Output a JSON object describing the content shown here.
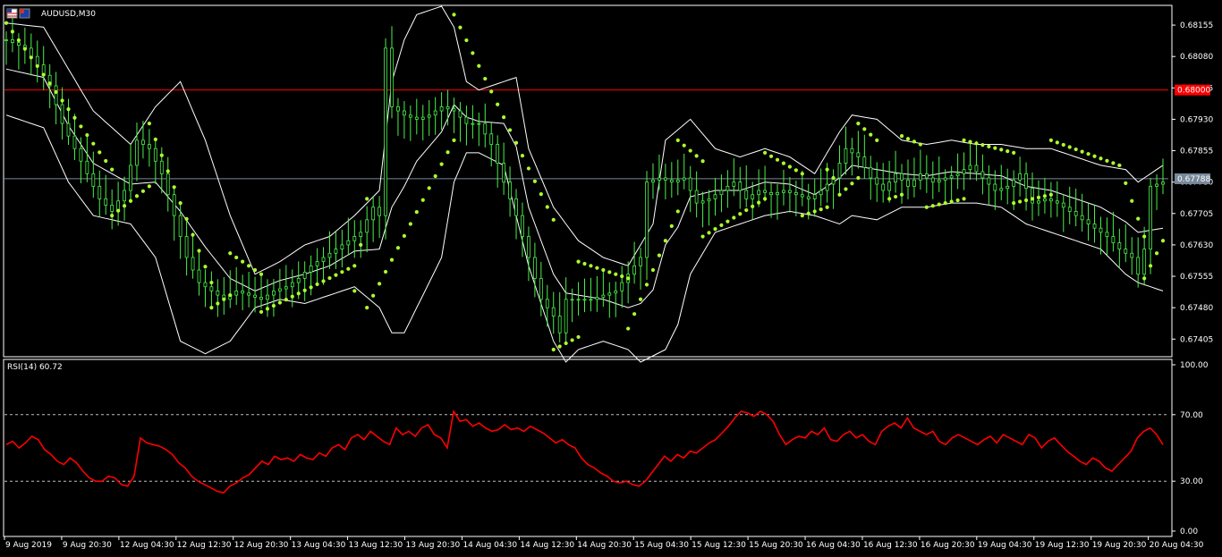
{
  "main_panel": {
    "symbol_label": "AUDUSD,M30",
    "flag_icon": "au-us-flag-icon"
  },
  "rsi_panel": {
    "label": "RSI(14) 60.72"
  },
  "colors": {
    "background": "#000000",
    "frame": "#ffffff",
    "candles": "#49f049",
    "bollinger": "#ffffff",
    "sar": "#adff2f",
    "rsi_line": "#ff0000",
    "level_line_red": "#ff0000",
    "bid_line": "#778899",
    "tag_bg": "#ff0000",
    "tag_bid_bg": "#778899"
  },
  "chart_data": [
    {
      "type": "line",
      "name": "AUDUSD M30 price (candles with Bollinger Bands and Parabolic SAR)",
      "y_ticks": [
        "0.68155",
        "0.68080",
        "0.68005",
        "0.67930",
        "0.67855",
        "0.67780",
        "0.67705",
        "0.67630",
        "0.67555",
        "0.67480",
        "0.67405"
      ],
      "ylim": [
        0.67365,
        0.682
      ],
      "horizontal_level": {
        "value": 0.68,
        "label": "0.68000"
      },
      "current_price": {
        "value": 0.67788,
        "label": "0.67788"
      },
      "x_ticks": [
        "9 Aug 2019",
        "9 Aug 20:30",
        "12 Aug 04:30",
        "12 Aug 12:30",
        "12 Aug 20:30",
        "13 Aug 04:30",
        "13 Aug 12:30",
        "13 Aug 20:30",
        "14 Aug 04:30",
        "14 Aug 12:30",
        "14 Aug 20:30",
        "15 Aug 04:30",
        "15 Aug 12:30",
        "15 Aug 20:30",
        "16 Aug 04:30",
        "16 Aug 12:30",
        "16 Aug 20:30",
        "19 Aug 04:30",
        "19 Aug 12:30",
        "19 Aug 20:30",
        "20 Aug 04:30"
      ],
      "close_path": [
        [
          0,
          0.6812
        ],
        [
          3,
          0.681
        ],
        [
          5,
          0.6806
        ],
        [
          7,
          0.6801
        ],
        [
          9,
          0.6792
        ],
        [
          11,
          0.6786
        ],
        [
          13,
          0.678
        ],
        [
          15,
          0.6774
        ],
        [
          17,
          0.6771
        ],
        [
          19,
          0.6776
        ],
        [
          21,
          0.6788
        ],
        [
          23,
          0.6786
        ],
        [
          25,
          0.678
        ],
        [
          27,
          0.677
        ],
        [
          29,
          0.676
        ],
        [
          31,
          0.6754
        ],
        [
          33,
          0.6752
        ],
        [
          35,
          0.675
        ],
        [
          37,
          0.6752
        ],
        [
          39,
          0.6751
        ],
        [
          41,
          0.675
        ],
        [
          43,
          0.6752
        ],
        [
          45,
          0.6753
        ],
        [
          47,
          0.6755
        ],
        [
          49,
          0.6758
        ],
        [
          51,
          0.676
        ],
        [
          53,
          0.6762
        ],
        [
          55,
          0.6764
        ],
        [
          57,
          0.6766
        ],
        [
          59,
          0.6772
        ],
        [
          60,
          0.677
        ],
        [
          61,
          0.681
        ],
        [
          62,
          0.6796
        ],
        [
          64,
          0.6794
        ],
        [
          66,
          0.6793
        ],
        [
          68,
          0.6794
        ],
        [
          70,
          0.6796
        ],
        [
          72,
          0.6795
        ],
        [
          74,
          0.6792
        ],
        [
          76,
          0.6792
        ],
        [
          78,
          0.6787
        ],
        [
          80,
          0.6778
        ],
        [
          82,
          0.677
        ],
        [
          84,
          0.676
        ],
        [
          86,
          0.675
        ],
        [
          88,
          0.6746
        ],
        [
          89,
          0.6742
        ],
        [
          90,
          0.675
        ],
        [
          92,
          0.675
        ],
        [
          94,
          0.675
        ],
        [
          96,
          0.6751
        ],
        [
          98,
          0.6752
        ],
        [
          100,
          0.6756
        ],
        [
          102,
          0.676
        ],
        [
          103,
          0.6778
        ],
        [
          105,
          0.6779
        ],
        [
          107,
          0.6778
        ],
        [
          109,
          0.6779
        ],
        [
          111,
          0.6773
        ],
        [
          113,
          0.6774
        ],
        [
          115,
          0.6776
        ],
        [
          117,
          0.6778
        ],
        [
          119,
          0.6774
        ],
        [
          121,
          0.6776
        ],
        [
          123,
          0.6775
        ],
        [
          125,
          0.6776
        ],
        [
          127,
          0.6775
        ],
        [
          129,
          0.6774
        ],
        [
          131,
          0.6776
        ],
        [
          133,
          0.6779
        ],
        [
          135,
          0.6786
        ],
        [
          137,
          0.6784
        ],
        [
          139,
          0.6779
        ],
        [
          141,
          0.6776
        ],
        [
          143,
          0.678
        ],
        [
          145,
          0.6777
        ],
        [
          147,
          0.678
        ],
        [
          149,
          0.6778
        ],
        [
          151,
          0.6779
        ],
        [
          153,
          0.678
        ],
        [
          155,
          0.6782
        ],
        [
          157,
          0.6779
        ],
        [
          159,
          0.6776
        ],
        [
          161,
          0.6777
        ],
        [
          163,
          0.678
        ],
        [
          165,
          0.6773
        ],
        [
          167,
          0.6774
        ],
        [
          169,
          0.6773
        ],
        [
          171,
          0.6771
        ],
        [
          173,
          0.6769
        ],
        [
          175,
          0.6767
        ],
        [
          177,
          0.6765
        ],
        [
          179,
          0.6762
        ],
        [
          181,
          0.676
        ],
        [
          182,
          0.6756
        ],
        [
          183,
          0.6762
        ],
        [
          184,
          0.6777
        ],
        [
          186,
          0.6778
        ]
      ],
      "bb_upper_path": [
        [
          0,
          0.6816
        ],
        [
          6,
          0.6815
        ],
        [
          10,
          0.6805
        ],
        [
          14,
          0.6795
        ],
        [
          20,
          0.6787
        ],
        [
          24,
          0.6796
        ],
        [
          28,
          0.6802
        ],
        [
          32,
          0.6788
        ],
        [
          36,
          0.677
        ],
        [
          40,
          0.6756
        ],
        [
          44,
          0.6759
        ],
        [
          48,
          0.6763
        ],
        [
          52,
          0.6765
        ],
        [
          56,
          0.677
        ],
        [
          60,
          0.6776
        ],
        [
          62,
          0.6802
        ],
        [
          64,
          0.6812
        ],
        [
          66,
          0.6818
        ],
        [
          70,
          0.682
        ],
        [
          72,
          0.6815
        ],
        [
          74,
          0.6802
        ],
        [
          76,
          0.68
        ],
        [
          80,
          0.6802
        ],
        [
          82,
          0.6803
        ],
        [
          84,
          0.6786
        ],
        [
          88,
          0.6772
        ],
        [
          92,
          0.6764
        ],
        [
          96,
          0.676
        ],
        [
          100,
          0.6758
        ],
        [
          104,
          0.6768
        ],
        [
          106,
          0.6788
        ],
        [
          110,
          0.6793
        ],
        [
          114,
          0.6786
        ],
        [
          118,
          0.6784
        ],
        [
          122,
          0.6786
        ],
        [
          126,
          0.6784
        ],
        [
          130,
          0.678
        ],
        [
          134,
          0.679
        ],
        [
          136,
          0.6794
        ],
        [
          140,
          0.6793
        ],
        [
          144,
          0.6788
        ],
        [
          148,
          0.6787
        ],
        [
          152,
          0.6788
        ],
        [
          156,
          0.6787
        ],
        [
          160,
          0.6787
        ],
        [
          164,
          0.6786
        ],
        [
          168,
          0.6786
        ],
        [
          172,
          0.6784
        ],
        [
          176,
          0.6782
        ],
        [
          180,
          0.6781
        ],
        [
          182,
          0.6778
        ],
        [
          184,
          0.678
        ],
        [
          186,
          0.6782
        ]
      ],
      "bb_lower_path": [
        [
          0,
          0.6794
        ],
        [
          6,
          0.6791
        ],
        [
          10,
          0.6778
        ],
        [
          14,
          0.677
        ],
        [
          20,
          0.6768
        ],
        [
          24,
          0.676
        ],
        [
          28,
          0.674
        ],
        [
          32,
          0.6737
        ],
        [
          36,
          0.674
        ],
        [
          40,
          0.6748
        ],
        [
          44,
          0.675
        ],
        [
          48,
          0.6749
        ],
        [
          52,
          0.6751
        ],
        [
          56,
          0.6753
        ],
        [
          60,
          0.6748
        ],
        [
          62,
          0.6742
        ],
        [
          64,
          0.6742
        ],
        [
          66,
          0.6748
        ],
        [
          70,
          0.676
        ],
        [
          72,
          0.6778
        ],
        [
          74,
          0.6785
        ],
        [
          76,
          0.6785
        ],
        [
          80,
          0.6782
        ],
        [
          82,
          0.677
        ],
        [
          84,
          0.6758
        ],
        [
          88,
          0.674
        ],
        [
          90,
          0.6735
        ],
        [
          92,
          0.6738
        ],
        [
          96,
          0.674
        ],
        [
          100,
          0.6738
        ],
        [
          102,
          0.6735
        ],
        [
          106,
          0.6738
        ],
        [
          108,
          0.6744
        ],
        [
          110,
          0.6756
        ],
        [
          114,
          0.6766
        ],
        [
          118,
          0.6768
        ],
        [
          122,
          0.677
        ],
        [
          126,
          0.6771
        ],
        [
          130,
          0.677
        ],
        [
          134,
          0.6768
        ],
        [
          136,
          0.677
        ],
        [
          140,
          0.6769
        ],
        [
          144,
          0.6772
        ],
        [
          148,
          0.6772
        ],
        [
          152,
          0.6773
        ],
        [
          156,
          0.6773
        ],
        [
          160,
          0.6772
        ],
        [
          164,
          0.6768
        ],
        [
          168,
          0.6766
        ],
        [
          172,
          0.6764
        ],
        [
          176,
          0.6762
        ],
        [
          180,
          0.6756
        ],
        [
          182,
          0.6754
        ],
        [
          184,
          0.6753
        ],
        [
          186,
          0.6752
        ]
      ],
      "sar_segments": [
        {
          "from": [
            0,
            0.6816
          ],
          "to": [
            17,
            0.6781
          ],
          "side": "above"
        },
        {
          "from": [
            17,
            0.677
          ],
          "to": [
            23,
            0.6777
          ],
          "side": "below"
        },
        {
          "from": [
            23,
            0.6792
          ],
          "to": [
            33,
            0.6754
          ],
          "side": "above"
        },
        {
          "from": [
            33,
            0.6748
          ],
          "to": [
            36,
            0.6751
          ],
          "side": "below"
        },
        {
          "from": [
            36,
            0.6761
          ],
          "to": [
            41,
            0.6756
          ],
          "side": "above"
        },
        {
          "from": [
            41,
            0.6747
          ],
          "to": [
            56,
            0.6758
          ],
          "side": "below"
        },
        {
          "from": [
            56,
            0.6752
          ],
          "to": [
            58,
            0.6774
          ],
          "side": "below"
        },
        {
          "from": [
            58,
            0.6748
          ],
          "to": [
            72,
            0.6788
          ],
          "side": "below"
        },
        {
          "from": [
            72,
            0.6818
          ],
          "to": [
            88,
            0.6769
          ],
          "side": "above"
        },
        {
          "from": [
            88,
            0.6738
          ],
          "to": [
            92,
            0.6741
          ],
          "side": "below"
        },
        {
          "from": [
            92,
            0.6759
          ],
          "to": [
            100,
            0.6755
          ],
          "side": "above"
        },
        {
          "from": [
            100,
            0.6743
          ],
          "to": [
            108,
            0.6771
          ],
          "side": "below"
        },
        {
          "from": [
            108,
            0.6788
          ],
          "to": [
            112,
            0.6783
          ],
          "side": "above"
        },
        {
          "from": [
            112,
            0.6765
          ],
          "to": [
            122,
            0.6774
          ],
          "side": "below"
        },
        {
          "from": [
            122,
            0.6785
          ],
          "to": [
            128,
            0.678
          ],
          "side": "above"
        },
        {
          "from": [
            128,
            0.677
          ],
          "to": [
            132,
            0.6772
          ],
          "side": "below"
        },
        {
          "from": [
            132,
            0.6781
          ],
          "to": [
            133,
            0.6779
          ],
          "side": "above"
        },
        {
          "from": [
            134,
            0.6775
          ],
          "to": [
            137,
            0.6779
          ],
          "side": "below"
        },
        {
          "from": [
            137,
            0.6792
          ],
          "to": [
            140,
            0.6788
          ],
          "side": "above"
        },
        {
          "from": [
            142,
            0.6774
          ],
          "to": [
            144,
            0.6775
          ],
          "side": "below"
        },
        {
          "from": [
            144,
            0.6789
          ],
          "to": [
            147,
            0.6787
          ],
          "side": "above"
        },
        {
          "from": [
            148,
            0.6772
          ],
          "to": [
            154,
            0.6774
          ],
          "side": "below"
        },
        {
          "from": [
            154,
            0.6788
          ],
          "to": [
            162,
            0.6785
          ],
          "side": "above"
        },
        {
          "from": [
            162,
            0.6773
          ],
          "to": [
            168,
            0.6775
          ],
          "side": "below"
        },
        {
          "from": [
            168,
            0.6788
          ],
          "to": [
            179,
            0.6782
          ],
          "side": "above"
        },
        {
          "from": [
            179,
            0.6782
          ],
          "to": [
            183,
            0.6765
          ],
          "side": "above"
        },
        {
          "from": [
            183,
            0.6755
          ],
          "to": [
            186,
            0.6764
          ],
          "side": "below"
        }
      ],
      "x_count": 187
    },
    {
      "type": "line",
      "name": "RSI(14)",
      "y_ticks": [
        "100.00",
        "70.00",
        "30.00",
        "0.00"
      ],
      "ylim": [
        0,
        100
      ],
      "levels": [
        70,
        30
      ],
      "last_value": 60.72,
      "x_count": 187,
      "values": [
        52,
        54,
        50,
        53,
        57,
        55,
        49,
        46,
        42,
        40,
        44,
        41,
        36,
        32,
        30,
        30,
        33,
        32,
        28,
        27,
        33,
        56,
        53,
        52,
        51,
        49,
        46,
        41,
        38,
        33,
        30,
        28,
        26,
        24,
        23,
        27,
        29,
        32,
        34,
        38,
        42,
        40,
        45,
        43,
        44,
        42,
        46,
        44,
        43,
        47,
        45,
        50,
        52,
        49,
        56,
        58,
        55,
        60,
        57,
        54,
        52,
        62,
        58,
        60,
        57,
        62,
        64,
        58,
        56,
        50,
        72,
        66,
        67,
        63,
        65,
        62,
        60,
        61,
        64,
        61,
        62,
        60,
        63,
        61,
        59,
        56,
        53,
        55,
        52,
        50,
        44,
        40,
        38,
        35,
        33,
        30,
        29,
        30,
        28,
        27,
        30,
        35,
        40,
        45,
        42,
        46,
        44,
        48,
        47,
        50,
        53,
        55,
        59,
        63,
        68,
        72,
        71,
        69,
        72,
        70,
        66,
        58,
        52,
        55,
        57,
        56,
        60,
        58,
        62,
        55,
        54,
        58,
        60,
        56,
        58,
        54,
        52,
        60,
        63,
        65,
        62,
        68,
        62,
        60,
        58,
        60,
        54,
        52,
        56,
        58,
        56,
        54,
        52,
        55,
        57,
        53,
        58,
        56,
        54,
        52,
        58,
        56,
        50,
        54,
        56,
        52,
        48,
        45,
        42,
        40,
        44,
        42,
        38,
        36,
        40,
        44,
        48,
        56,
        60,
        62,
        58,
        52
      ]
    }
  ]
}
